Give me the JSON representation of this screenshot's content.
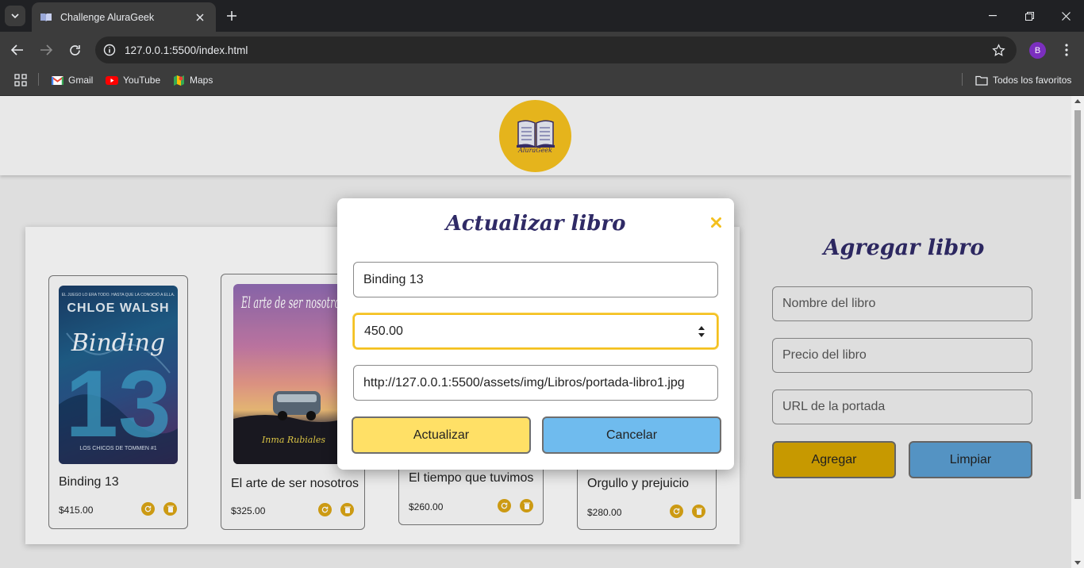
{
  "browser": {
    "tab_title": "Challenge AluraGeek",
    "url": "127.0.0.1:5500/index.html",
    "profile_initial": "B",
    "bookmarks": [
      {
        "label": "Gmail",
        "icon": "gmail-icon"
      },
      {
        "label": "YouTube",
        "icon": "youtube-icon"
      },
      {
        "label": "Maps",
        "icon": "maps-icon"
      }
    ],
    "all_bookmarks": "Todos los favoritos"
  },
  "header": {
    "logo_text": "AluraGeek"
  },
  "products": [
    {
      "name": "Binding 13",
      "price": "$415.00",
      "cover_title": "Binding",
      "cover_author": "CHLOE WALSH",
      "cover_num": "13",
      "cover_series": "LOS CHICOS DE TOMMEN #1",
      "cover_tagline": "EL JUEGO LO ERA TODO. HASTA QUE LA CONOCIÓ A ELLA."
    },
    {
      "name": "El arte de ser nosotros",
      "price": "$325.00",
      "cover_title": "El arte de ser nosotros",
      "cover_author": "Inma Rubiales"
    },
    {
      "name": "El tiempo que tuvimos",
      "price": "$260.00"
    },
    {
      "name": "Orgullo y prejuicio",
      "price": "$280.00"
    }
  ],
  "add_form": {
    "title": "Agregar libro",
    "name_placeholder": "Nombre del libro",
    "price_placeholder": "Precio del libro",
    "url_placeholder": "URL de la portada",
    "add_label": "Agregar",
    "clear_label": "Limpiar"
  },
  "modal": {
    "title": "Actualizar libro",
    "name_value": "Binding 13",
    "price_value": "450.00",
    "url_value": "http://127.0.0.1:5500/assets/img/Libros/portada-libro1.jpg",
    "update_label": "Actualizar",
    "cancel_label": "Cancelar"
  },
  "colors": {
    "accent_yellow": "#f4c01e",
    "button_yellow": "#ffe066",
    "button_blue": "#6fbbee",
    "title_purple": "#2f2a66"
  }
}
